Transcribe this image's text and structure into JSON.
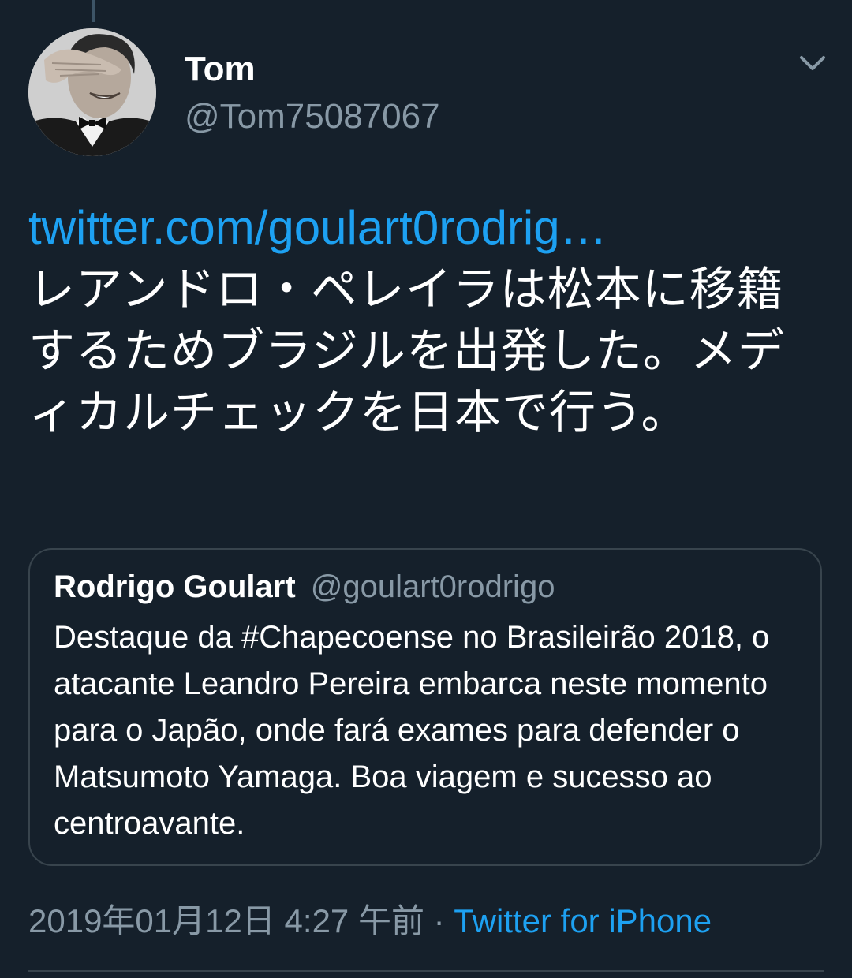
{
  "author": {
    "name": "Tom",
    "handle": "@Tom75087067"
  },
  "tweet": {
    "link_text": "twitter.com/goulart0rodrig…",
    "text": "レアンドロ・ペレイラは松本に移籍するためブラジルを出発した。メディカルチェックを日本で行う。"
  },
  "quote": {
    "name": "Rodrigo Goulart",
    "handle": "@goulart0rodrigo",
    "text": "Destaque da #Chapecoense no Brasileirão 2018, o atacante Leandro Pereira embarca neste momento para o Japão, onde fará exames para defender o Matsumoto Yamaga. Boa viagem e sucesso ao centroavante."
  },
  "meta": {
    "timestamp": "2019年01月12日 4:27 午前",
    "separator": "·",
    "source": "Twitter for iPhone"
  },
  "icons": {
    "menu": "chevron-down-icon",
    "avatar": "avatar"
  },
  "colors": {
    "background": "#15202b",
    "link": "#1da1f2",
    "secondary_text": "#8899a6",
    "border": "#38444d"
  }
}
